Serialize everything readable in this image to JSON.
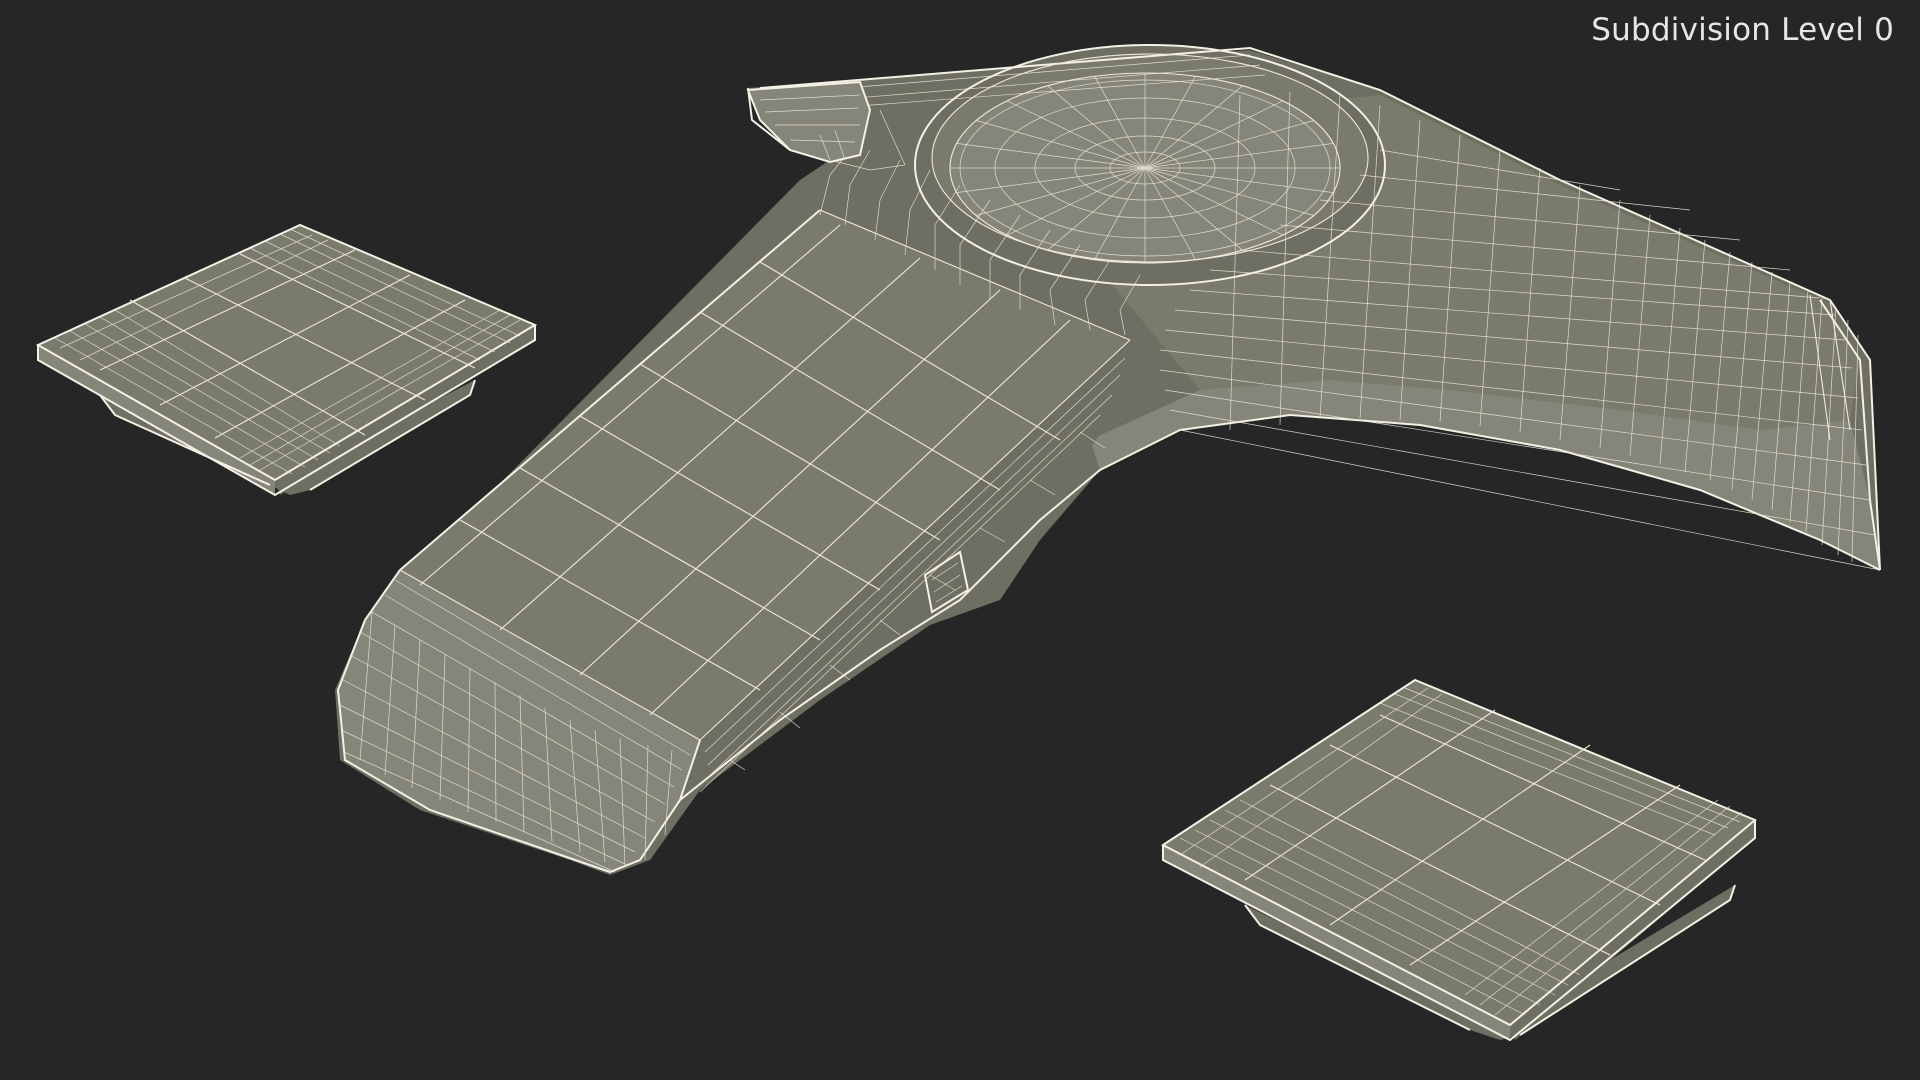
{
  "viewport": {
    "label": "Subdivision Level 0",
    "background": "#262626",
    "mesh_fill": "#7a7a6d",
    "wire_color": "#eeeadc"
  },
  "objects": [
    {
      "name": "main-body"
    },
    {
      "name": "foot-pad-left"
    },
    {
      "name": "foot-pad-right"
    }
  ]
}
